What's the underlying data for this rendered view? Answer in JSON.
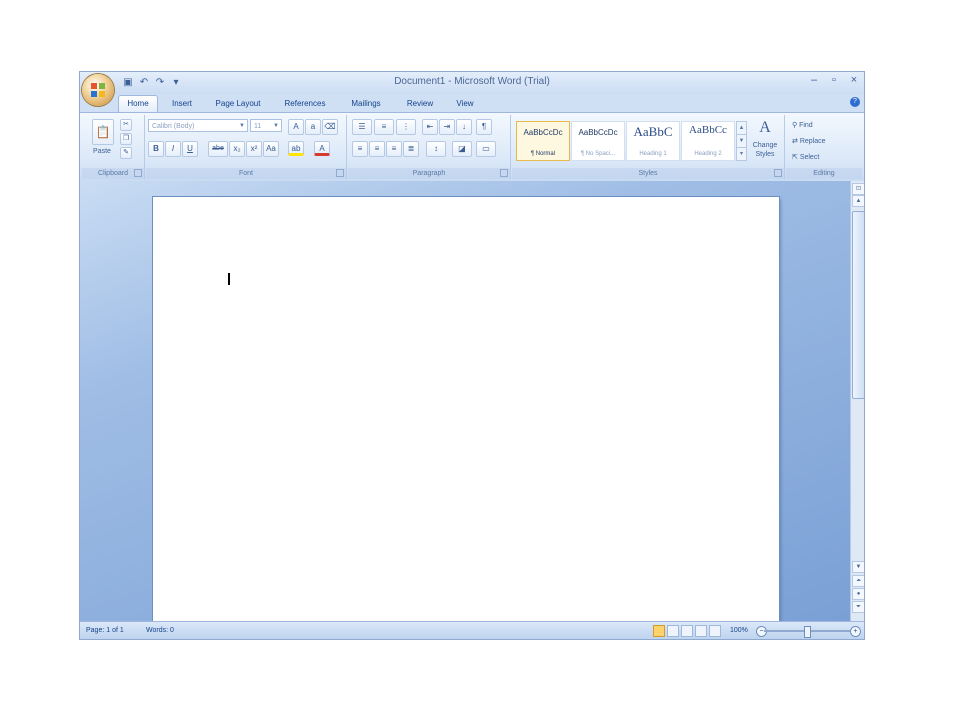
{
  "window": {
    "title": "Document1 - Microsoft Word (Trial)",
    "controls": {
      "minimize": "–",
      "maximize": "▫",
      "close": "×"
    }
  },
  "quick_access": {
    "save": "▣",
    "undo": "↶",
    "redo": "↷",
    "customize": "▾"
  },
  "tabs": [
    {
      "label": "Home",
      "active": true
    },
    {
      "label": "Insert"
    },
    {
      "label": "Page Layout"
    },
    {
      "label": "References"
    },
    {
      "label": "Mailings"
    },
    {
      "label": "Review"
    },
    {
      "label": "View"
    }
  ],
  "ribbon": {
    "clipboard": {
      "label": "Clipboard",
      "paste": "Paste",
      "paste_icon": "clipboard-icon"
    },
    "font": {
      "label": "Font",
      "font_name": "Calibri (Body)",
      "font_size": "11",
      "bold": "B",
      "italic": "I",
      "underline": "U",
      "strike": "abe",
      "subscript": "x₂",
      "superscript": "x²",
      "change_case": "Aa",
      "grow": "A",
      "shrink": "a",
      "clear": "⌫",
      "highlight": "ab",
      "font_color": "A"
    },
    "paragraph": {
      "label": "Paragraph",
      "pilcrow": "¶"
    },
    "styles": {
      "label": "Styles",
      "items": [
        {
          "sample": "AaBbCcDc",
          "name": "¶ Normal",
          "selected": true
        },
        {
          "sample": "AaBbCcDc",
          "name": "¶ No Spaci..."
        },
        {
          "sample": "AaBbC",
          "name": "Heading 1"
        },
        {
          "sample": "AaBbCc",
          "name": "Heading 2"
        }
      ],
      "change_styles": "Change Styles"
    },
    "editing": {
      "label": "Editing",
      "find": "Find",
      "replace": "Replace",
      "select": "Select"
    }
  },
  "status": {
    "page": "Page: 1 of 1",
    "words": "Words: 0",
    "zoom": "100%"
  },
  "colors": {
    "accent": "#15428b",
    "ribbon": "#dbe8f8",
    "workspace": "#7aa0d5"
  }
}
